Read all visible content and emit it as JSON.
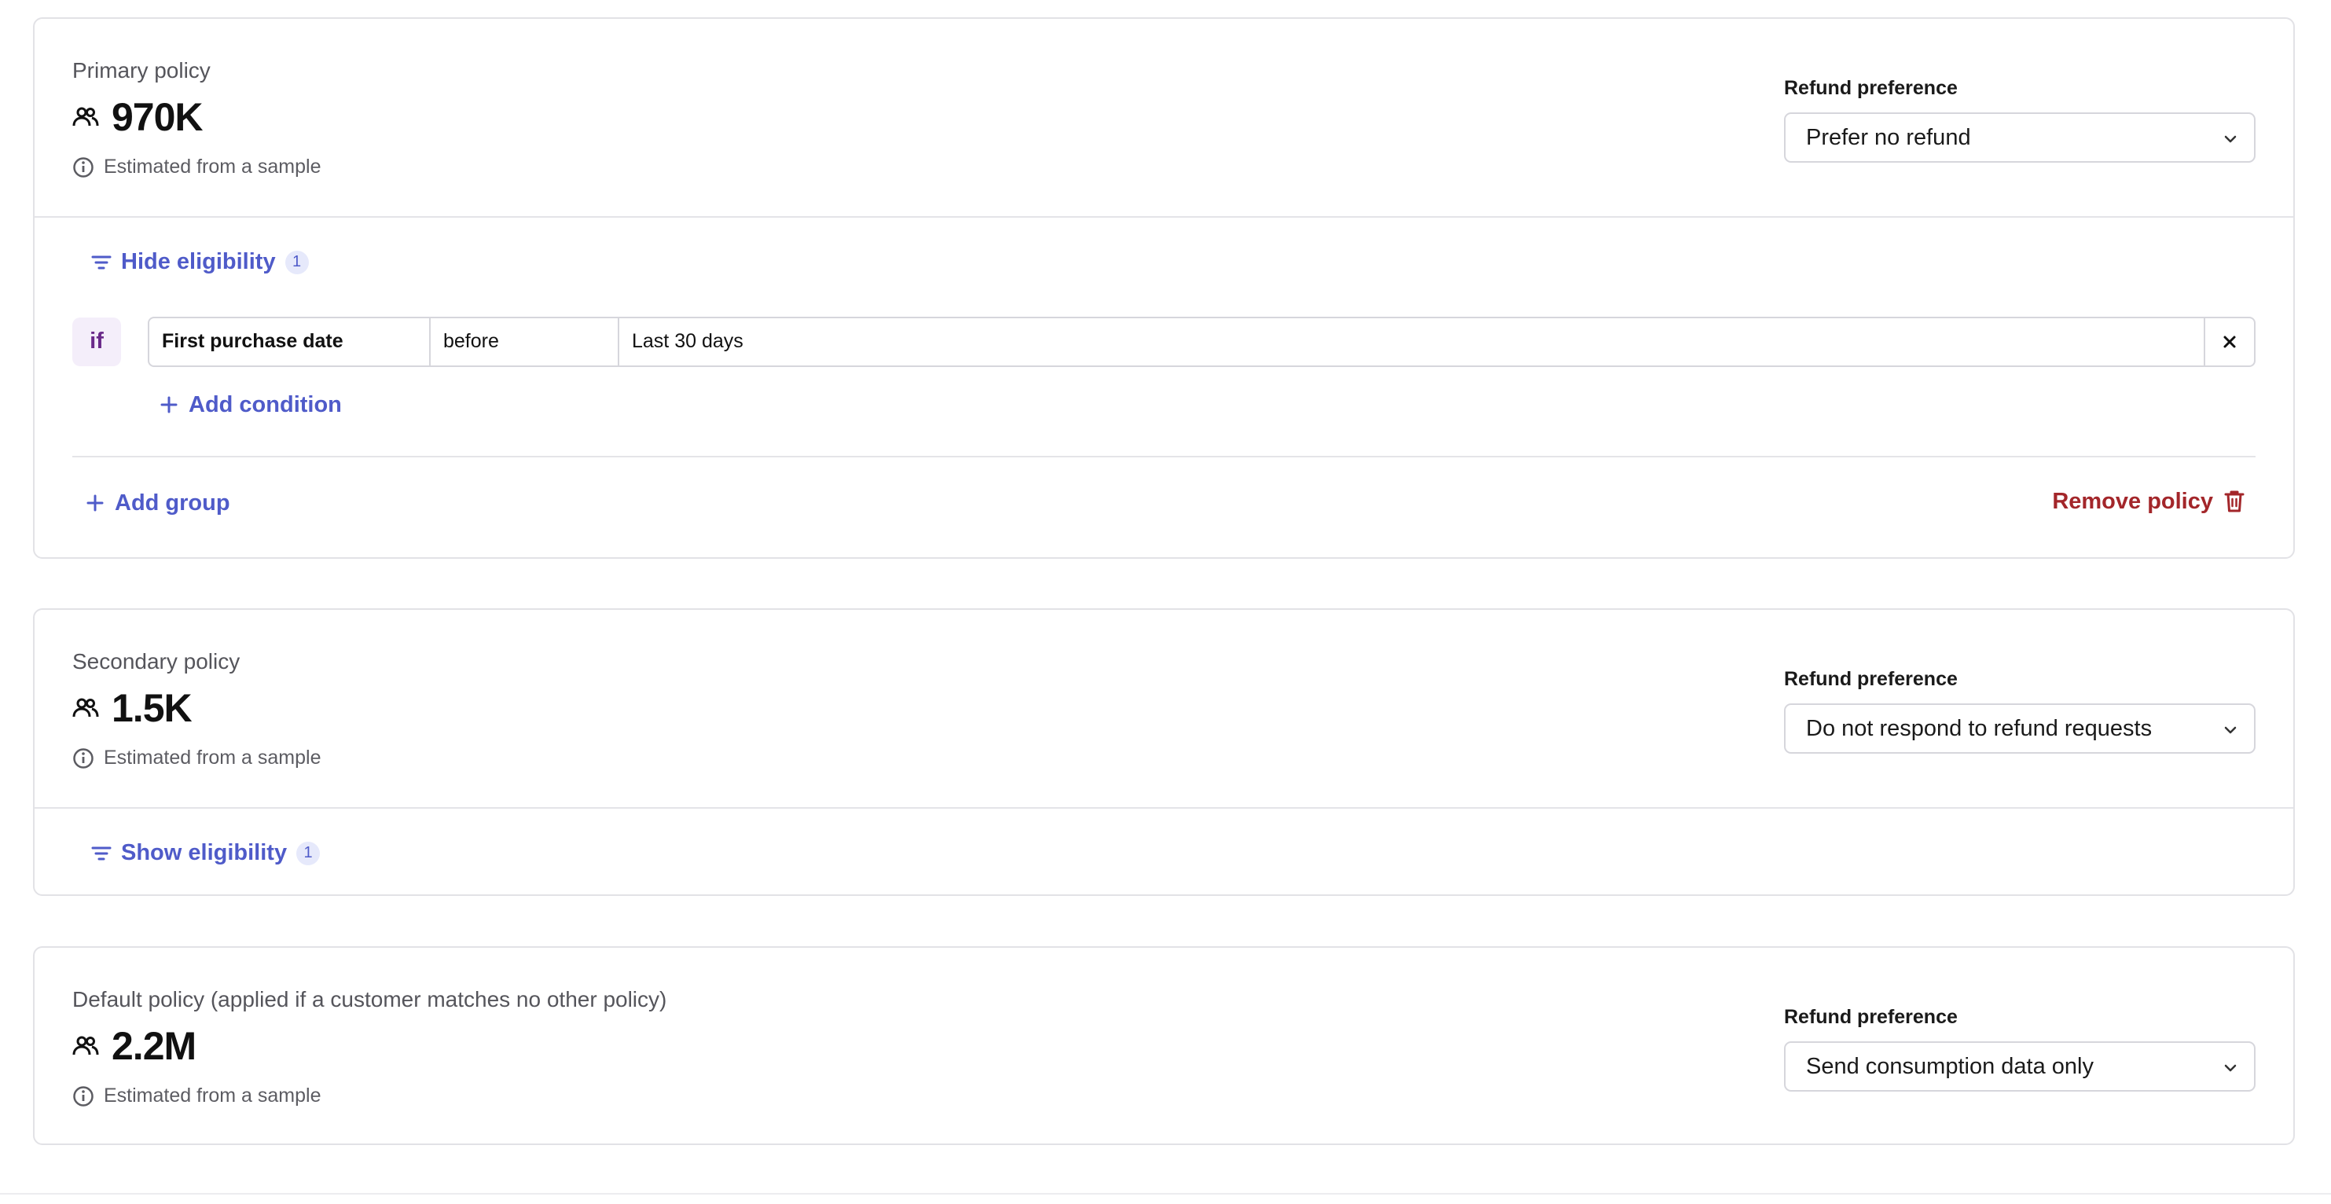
{
  "policies": [
    {
      "name": "Primary policy",
      "count": "970K",
      "estimate": "Estimated from a sample",
      "pref_label": "Refund preference",
      "pref_value": "Prefer no refund",
      "eligibility_toggle": "Hide eligibility",
      "eligibility_count": "1",
      "condition": {
        "if_label": "if",
        "attribute": "First purchase date",
        "operator": "before",
        "value": "Last 30 days"
      },
      "add_condition": "Add condition",
      "add_group": "Add group",
      "remove_policy": "Remove policy"
    },
    {
      "name": "Secondary policy",
      "count": "1.5K",
      "estimate": "Estimated from a sample",
      "pref_label": "Refund preference",
      "pref_value": "Do not respond to refund requests",
      "eligibility_toggle": "Show eligibility",
      "eligibility_count": "1"
    },
    {
      "name": "Default policy (applied if a customer matches no other policy)",
      "count": "2.2M",
      "estimate": "Estimated from a sample",
      "pref_label": "Refund preference",
      "pref_value": "Send consumption data only"
    }
  ],
  "colors": {
    "accent": "#4f5bc9",
    "danger": "#a3262a",
    "if_badge_bg": "#f4eefa",
    "border": "#e2e2e6"
  },
  "icons": {
    "people": "people-icon",
    "info": "info-icon",
    "filter": "filter-icon",
    "plus": "plus-icon",
    "close": "close-icon",
    "trash": "trash-icon",
    "chevron": "chevron-down-icon"
  }
}
